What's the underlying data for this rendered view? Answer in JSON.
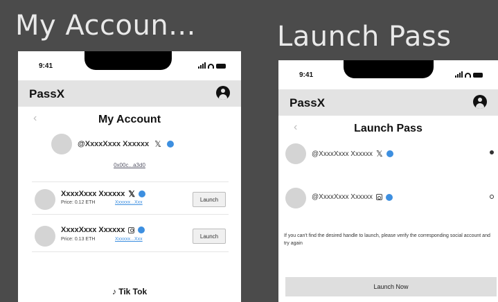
{
  "frames": [
    {
      "title": "My Accoun...",
      "status_time": "9:41",
      "app_name": "PassX",
      "page_title": "My Account",
      "back_icon": "‹",
      "profile_handle": "@XxxxXxxx Xxxxxx",
      "wallet": "0x00c...a3d0",
      "passes": [
        {
          "name": "XxxxXxxx Xxxxxx",
          "price": "Price: 0.12 ETH",
          "link": "Xxxxxx...Xxx",
          "network": "x",
          "button": "Launch"
        },
        {
          "name": "XxxxXxxx Xxxxxx",
          "price": "Price: 0.13 ETH",
          "link": "Xxxxxx...Xxx",
          "network": "instagram",
          "button": "Launch"
        }
      ],
      "footer_label": "Tik Tok",
      "footer_icon": "♪"
    },
    {
      "title": "Launch Pass",
      "status_time": "9:41",
      "app_name": "PassX",
      "page_title": "Launch Pass",
      "back_icon": "‹",
      "accounts": [
        {
          "handle": "@XxxxXxxx Xxxxxx",
          "network": "x",
          "selected": true
        },
        {
          "handle": "@XxxxXxxx Xxxxxx",
          "network": "instagram",
          "selected": false
        }
      ],
      "helper_text": "If you can't find the desired handle to launch, please verify the corresponding social account and try again",
      "launch_button": "Launch Now"
    }
  ],
  "x_glyph": "𝕏",
  "colors": {
    "background": "#4b4b4b",
    "verified": "#3d8fe0",
    "appbar": "#e3e3e3"
  }
}
